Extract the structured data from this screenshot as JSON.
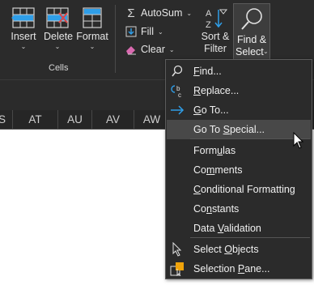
{
  "ribbon": {
    "cells_group": {
      "label": "Cells",
      "insert": "Insert",
      "delete": "Delete",
      "format": "Format"
    },
    "editing": {
      "autosum": "AutoSum",
      "fill": "Fill",
      "clear": "Clear",
      "sort_filter": [
        "Sort &",
        "Filter"
      ],
      "find_select": [
        "Find &",
        "Select"
      ]
    }
  },
  "columns": [
    "S",
    "AT",
    "AU",
    "AV",
    "AW"
  ],
  "menu": {
    "items": [
      {
        "pre": "",
        "ul": "F",
        "post": "ind...",
        "icon": "search-icon"
      },
      {
        "pre": "",
        "ul": "R",
        "post": "eplace...",
        "icon": "replace-icon"
      },
      {
        "pre": "",
        "ul": "G",
        "post": "o To...",
        "icon": "arrow-right-icon"
      },
      {
        "pre": "Go To ",
        "ul": "S",
        "post": "pecial...",
        "icon": ""
      },
      {
        "pre": "Form",
        "ul": "u",
        "post": "las",
        "icon": ""
      },
      {
        "pre": "Co",
        "ul": "m",
        "post": "ments",
        "icon": ""
      },
      {
        "pre": "",
        "ul": "C",
        "post": "onditional Formatting",
        "icon": ""
      },
      {
        "pre": "Co",
        "ul": "n",
        "post": "stants",
        "icon": ""
      },
      {
        "pre": "Data ",
        "ul": "V",
        "post": "alidation",
        "icon": ""
      },
      {
        "pre": "Select ",
        "ul": "O",
        "post": "bjects",
        "icon": "select-objects-icon"
      },
      {
        "pre": "Selection ",
        "ul": "P",
        "post": "ane...",
        "icon": "selection-pane-icon"
      }
    ],
    "hovered_index": 3
  },
  "colors": {
    "ribbon_bg": "#2b2b2b",
    "menu_bg": "#2b2b2b",
    "hover_bg": "#484848",
    "icon_blue": "#2f9ee8",
    "icon_red": "#e04646",
    "icon_orange": "#f0a30a"
  }
}
